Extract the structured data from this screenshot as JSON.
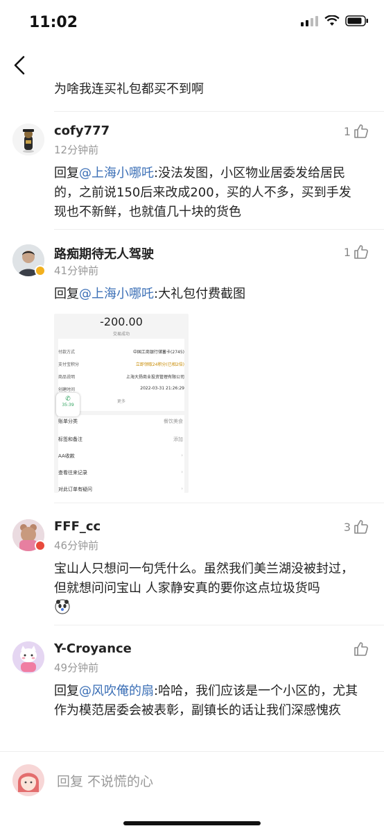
{
  "status_bar": {
    "time": "11:02"
  },
  "partial_comment": {
    "text": "为啥我连买礼包都买不到啊"
  },
  "comments": [
    {
      "username": "cofy777",
      "time": "12分钟前",
      "likes": "1",
      "reply_prefix": "回复",
      "mention": "@上海小哪吒",
      "text": ":没法发图，小区物业居委发给居民的，之前说150后来改成200，买的人不多，买到手发现也不新鲜，也就值几十块的货色"
    },
    {
      "username": "路痴期待无人驾驶",
      "time": "41分钟前",
      "likes": "1",
      "reply_prefix": "回复",
      "mention": "@上海小哪吒",
      "text": ":大礼包付费截图",
      "screenshot": {
        "amount": "-200.00",
        "status": "交易成功",
        "rows": [
          {
            "label": "付款方式",
            "value": "中国工商银行储蓄卡(2745)"
          },
          {
            "label": "支付宝积分",
            "value": "立即领取24积分(已相2倍)"
          },
          {
            "label": "商品说明",
            "value": "上海大扬商业投资管理有限公司"
          },
          {
            "label": "创建时间",
            "value": "2022-03-31 21:26:29"
          }
        ],
        "more": "更多",
        "call_time": "35:39",
        "list_rows": [
          {
            "label": "账单分类",
            "value": "餐饮美食"
          },
          {
            "label": "标签和备注",
            "value": "添加"
          },
          {
            "label": "AA收款",
            "value": ""
          },
          {
            "label": "查看往来记录",
            "value": ""
          },
          {
            "label": "对此订单有疑问",
            "value": ""
          }
        ]
      }
    },
    {
      "username": "FFF_cc",
      "time": "46分钟前",
      "likes": "3",
      "text": "宝山人只想问一句凭什么。虽然我们美兰湖没被封过，但就想问问宝山 人家静安真的要你这点垃圾货吗"
    },
    {
      "username": "Y-Croyance",
      "time": "49分钟前",
      "likes": "",
      "reply_prefix": "回复",
      "mention": "@风吹俺的扇",
      "text": ":哈哈，我们应该是一个小区的，尤其作为模范居委会被表彰，副镇长的话让我们深感愧疚"
    }
  ],
  "reply_bar": {
    "placeholder": "回复 不说慌的心"
  },
  "colors": {
    "mention": "#3b6fb6",
    "secondary_text": "#999999",
    "verified_badge": "#f2b01e",
    "red_badge": "#e84a3c"
  }
}
